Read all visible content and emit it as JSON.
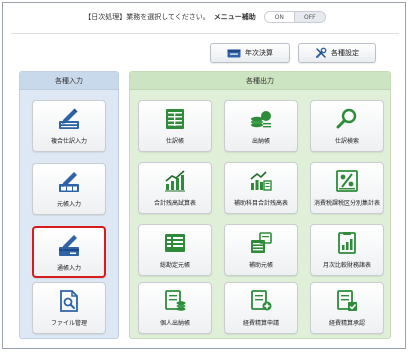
{
  "header": {
    "instruction": "【日次処理】業務を選択してください。",
    "mode_label": "メニュー補助",
    "toggle_on": "ON",
    "toggle_off": "OFF"
  },
  "toolbar": {
    "year_end_label": "年次決算",
    "settings_label": "各種設定"
  },
  "left_panel": {
    "title": "各種入力",
    "items": [
      {
        "label": "複合仕訳入力",
        "icon": "pencil-list-icon"
      },
      {
        "label": "元帳入力",
        "icon": "pencil-ledger-icon"
      },
      {
        "label": "通帳入力",
        "icon": "pencil-card-icon",
        "selected": true
      },
      {
        "label": "ファイル管理",
        "icon": "document-search-icon"
      }
    ]
  },
  "right_panel": {
    "title": "各種出力",
    "items": [
      {
        "label": "仕訳帳",
        "icon": "journal-icon"
      },
      {
        "label": "出納帳",
        "icon": "cashbook-icon"
      },
      {
        "label": "仕訳検索",
        "icon": "search-icon"
      },
      {
        "label": "合計残高試算表",
        "icon": "trial-balance-icon"
      },
      {
        "label": "補助科目合計残高表",
        "icon": "sub-account-icon"
      },
      {
        "label": "消費税課税区分別集計表",
        "icon": "percent-icon"
      },
      {
        "label": "総勘定元帳",
        "icon": "general-ledger-icon"
      },
      {
        "label": "補助元帳",
        "icon": "sub-ledger-icon"
      },
      {
        "label": "月次比較財務諸表",
        "icon": "monthly-compare-icon"
      },
      {
        "label": "個人出納帳",
        "icon": "personal-cashbook-icon"
      },
      {
        "label": "経費精算申請",
        "icon": "expense-request-icon"
      },
      {
        "label": "経費精算承認",
        "icon": "expense-approve-icon"
      }
    ]
  },
  "colors": {
    "icon_green": "#2e8b3a",
    "icon_blue": "#2f63a7",
    "selected_border": "#d81b1b"
  }
}
